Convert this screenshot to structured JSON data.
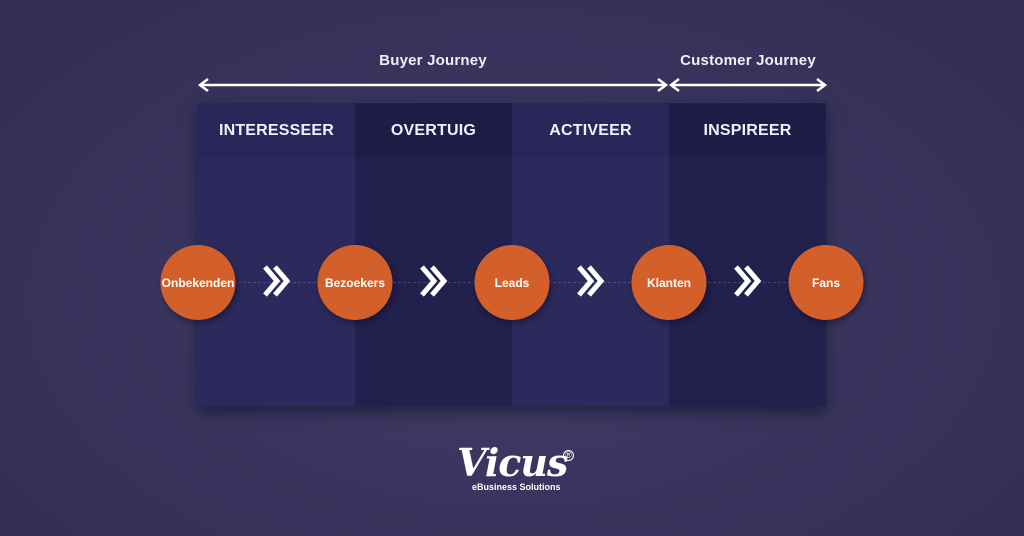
{
  "journeys": [
    {
      "label": "Buyer Journey"
    },
    {
      "label": "Customer Journey"
    }
  ],
  "columns": [
    {
      "label": "INTERESSEER"
    },
    {
      "label": "OVERTUIG"
    },
    {
      "label": "ACTIVEER"
    },
    {
      "label": "INSPIREER"
    }
  ],
  "stages": [
    {
      "label": "Onbekenden"
    },
    {
      "label": "Bezoekers"
    },
    {
      "label": "Leads"
    },
    {
      "label": "Klanten"
    },
    {
      "label": "Fans"
    }
  ],
  "colors": {
    "stage_circle": "#d3602a",
    "column_light": "#2c2a5c",
    "column_dark": "#22204c",
    "background": "#3b3660"
  },
  "logo": {
    "name": "Vicus",
    "registered": "®",
    "tagline": "eBusiness Solutions"
  }
}
